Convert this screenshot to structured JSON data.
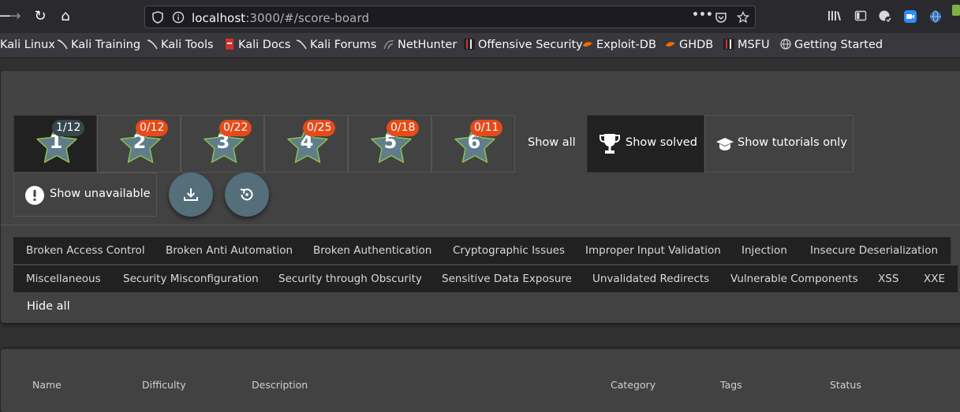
{
  "browser": {
    "url_host": "localhost",
    "url_rest": ":3000/#/score-board",
    "url_more_label": "•••",
    "bookmarks": [
      {
        "label": "Kali Linux",
        "icon": "kali-icon"
      },
      {
        "label": "Kali Training",
        "icon": "kali-icon"
      },
      {
        "label": "Kali Tools",
        "icon": "kali-icon"
      },
      {
        "label": "Kali Docs",
        "icon": "kali-docs-icon"
      },
      {
        "label": "Kali Forums",
        "icon": "kali-icon"
      },
      {
        "label": "NetHunter",
        "icon": "nethunter-icon"
      },
      {
        "label": "Offensive Security",
        "icon": "offsec-icon"
      },
      {
        "label": "Exploit-DB",
        "icon": "exploitdb-icon"
      },
      {
        "label": "GHDB",
        "icon": "ghdb-icon"
      },
      {
        "label": "MSFU",
        "icon": "offsec-icon"
      },
      {
        "label": "Getting Started",
        "icon": "globe-icon"
      }
    ]
  },
  "difficulty": [
    {
      "level": "1",
      "progress": "1/12",
      "active": true
    },
    {
      "level": "2",
      "progress": "0/12",
      "active": false
    },
    {
      "level": "3",
      "progress": "0/22",
      "active": false
    },
    {
      "level": "4",
      "progress": "0/25",
      "active": false
    },
    {
      "level": "5",
      "progress": "0/18",
      "active": false
    },
    {
      "level": "6",
      "progress": "0/11",
      "active": false
    }
  ],
  "filters": {
    "show_all": "Show all",
    "show_solved": "Show solved",
    "show_tutorials": "Show tutorials only",
    "show_unavailable": "Show unavailable",
    "hide_all": "Hide all"
  },
  "categories_row1": [
    "Broken Access Control",
    "Broken Anti Automation",
    "Broken Authentication",
    "Cryptographic Issues",
    "Improper Input Validation",
    "Injection",
    "Insecure Deserialization"
  ],
  "categories_row2": [
    "Miscellaneous",
    "Security Misconfiguration",
    "Security through Obscurity",
    "Sensitive Data Exposure",
    "Unvalidated Redirects",
    "Vulnerable Components",
    "XSS",
    "XXE"
  ],
  "table": {
    "headers": [
      "Name",
      "Difficulty",
      "Description",
      "Category",
      "Tags",
      "Status"
    ]
  },
  "colors": {
    "accent_badge": "#e64a19",
    "fab": "#546e7a",
    "star_fill": "#607d8b",
    "star_stroke": "#8bc34a"
  }
}
